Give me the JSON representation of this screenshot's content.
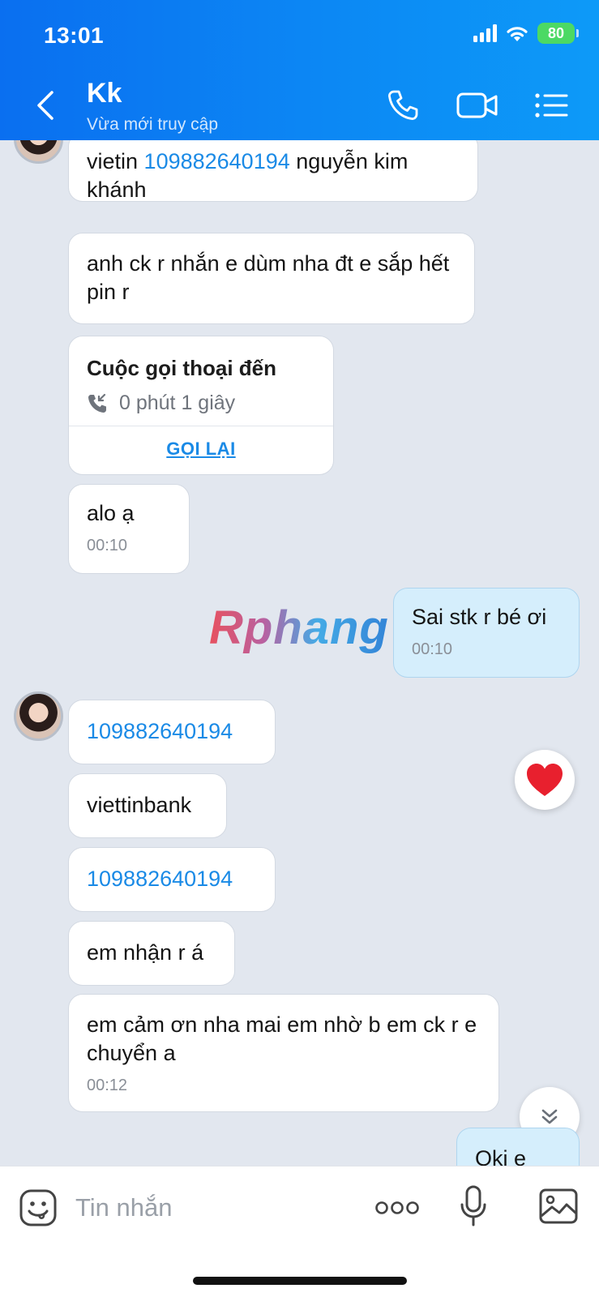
{
  "status_bar": {
    "time": "13:01",
    "battery": "80"
  },
  "header": {
    "contact_name": "Kk",
    "contact_status": "Vừa mới truy cập",
    "back_icon": "chevron-left-icon",
    "call_icon": "phone-icon",
    "video_icon": "video-camera-icon",
    "menu_icon": "list-menu-icon"
  },
  "messages": {
    "m1": {
      "prefix": "vietin ",
      "link": "109882640194",
      "suffix": " nguyễn kim khánh"
    },
    "m2": {
      "text": "anh ck r nhắn e dùm nha đt e sắp hết pin r"
    },
    "call": {
      "title": "Cuộc gọi thoại đến",
      "duration": "0 phút 1 giây",
      "action": "GỌI LẠI"
    },
    "m4": {
      "text": "alo ạ",
      "time": "00:10"
    },
    "m5": {
      "text": "Sai stk r bé ơi",
      "time": "00:10"
    },
    "m6": {
      "link": "109882640194"
    },
    "m7": {
      "text": "viettinbank"
    },
    "m8": {
      "link": "109882640194"
    },
    "m9": {
      "text": "em nhận r á"
    },
    "m10": {
      "text": "em cảm ơn nha mai em nhờ b em ck r e chuyển a",
      "time": "00:12"
    },
    "m11": {
      "text": "Oki e"
    }
  },
  "watermark": "Rphang",
  "reaction": {
    "icon": "heart-icon",
    "color": "#e8202e"
  },
  "composer": {
    "placeholder": "Tin nhắn"
  },
  "colors": {
    "header": "#0c88f4",
    "link": "#1a8ae6",
    "sent_bubble": "#d5eefc",
    "chat_bg": "#e2e7ef"
  }
}
